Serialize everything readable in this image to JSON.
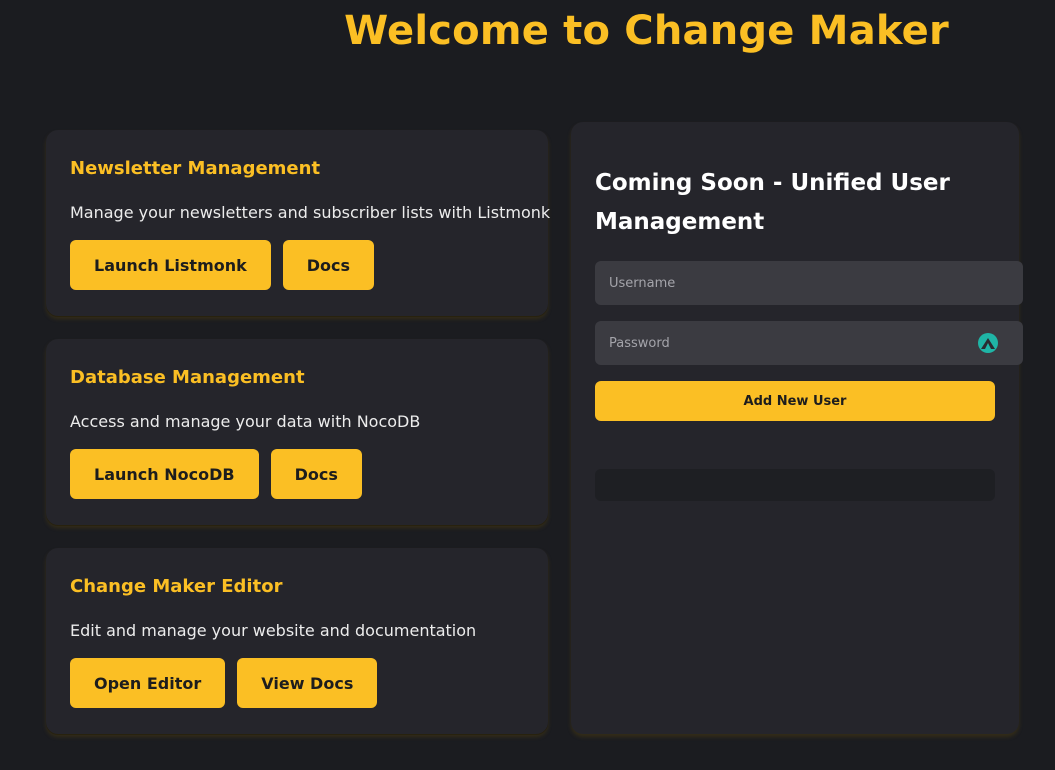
{
  "header": {
    "title": "Welcome to Change Maker"
  },
  "cards": [
    {
      "title": "Newsletter Management",
      "description": "Manage your newsletters and subscriber lists with Listmonk",
      "primary_label": "Launch Listmonk",
      "secondary_label": "Docs"
    },
    {
      "title": "Database Management",
      "description": "Access and manage your data with NocoDB",
      "primary_label": "Launch NocoDB",
      "secondary_label": "Docs"
    },
    {
      "title": "Change Maker Editor",
      "description": "Edit and manage your website and documentation",
      "primary_label": "Open Editor",
      "secondary_label": "View Docs"
    }
  ],
  "user_panel": {
    "title": "Coming Soon - Unified User Management",
    "username_placeholder": "Username",
    "password_placeholder": "Password",
    "password_icon": "password-manager-icon",
    "submit_label": "Add New User",
    "status_message": ""
  },
  "colors": {
    "accent": "#fbbf24",
    "background": "#1b1c20",
    "card": "#25252b",
    "field": "#3b3b41",
    "icon": "#1fb5a6"
  }
}
